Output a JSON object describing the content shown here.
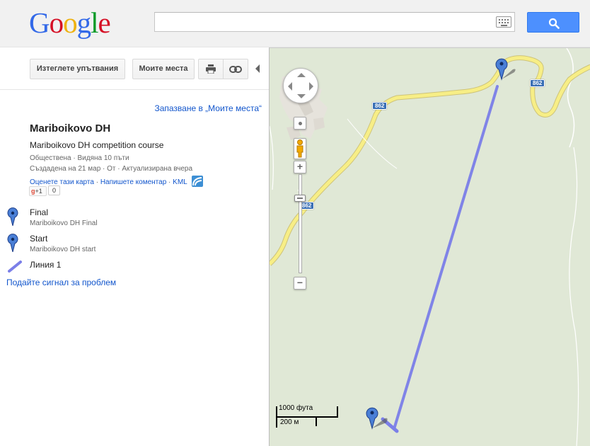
{
  "header": {
    "logo_letters": [
      {
        "ch": "G",
        "color": "#3369e8"
      },
      {
        "ch": "o",
        "color": "#d50f25"
      },
      {
        "ch": "o",
        "color": "#eeb211"
      },
      {
        "ch": "g",
        "color": "#3369e8"
      },
      {
        "ch": "l",
        "color": "#009925"
      },
      {
        "ch": "e",
        "color": "#d50f25"
      }
    ],
    "search_value": "",
    "keyboard_icon": "keyboard-icon",
    "search_button_icon": "search-icon"
  },
  "toolbar": {
    "clear_label": "Изтеглете упътвания",
    "my_places_label": "Моите места",
    "print_icon": "print-icon",
    "link_icon": "link-icon"
  },
  "place": {
    "save_link": "Запазване в „Моите места“",
    "title": "Mariboikovo DH",
    "description": "Mariboikovo DH competition course",
    "meta_line1": "Обществена · Видяна 10 пъти",
    "meta_line2": "Създадена на 21 мар · От  · Актуализирана вчера",
    "rate_link": "Оценете тази карта",
    "comment_link": "Напишете коментар",
    "kml_link": "KML",
    "plus_one_label": "+1",
    "plus_one_count": "0"
  },
  "features": [
    {
      "name": "Final",
      "desc": "Mariboikovo DH Final",
      "icon": "blue-pin-icon"
    },
    {
      "name": "Start",
      "desc": "Mariboikovo DH start",
      "icon": "blue-pin-icon"
    },
    {
      "name": "Линия 1",
      "desc": "",
      "icon": "line-icon"
    }
  ],
  "report_link": "Подайте сигнал за проблем",
  "map": {
    "road_number": "862",
    "scale_imperial": "1000 фута",
    "scale_metric": "200 м",
    "colors": {
      "terrain": "#e0e8d6",
      "road": "#f7ee86",
      "route_line": "#7b7fe8",
      "marker": "#4a7fd6"
    }
  }
}
